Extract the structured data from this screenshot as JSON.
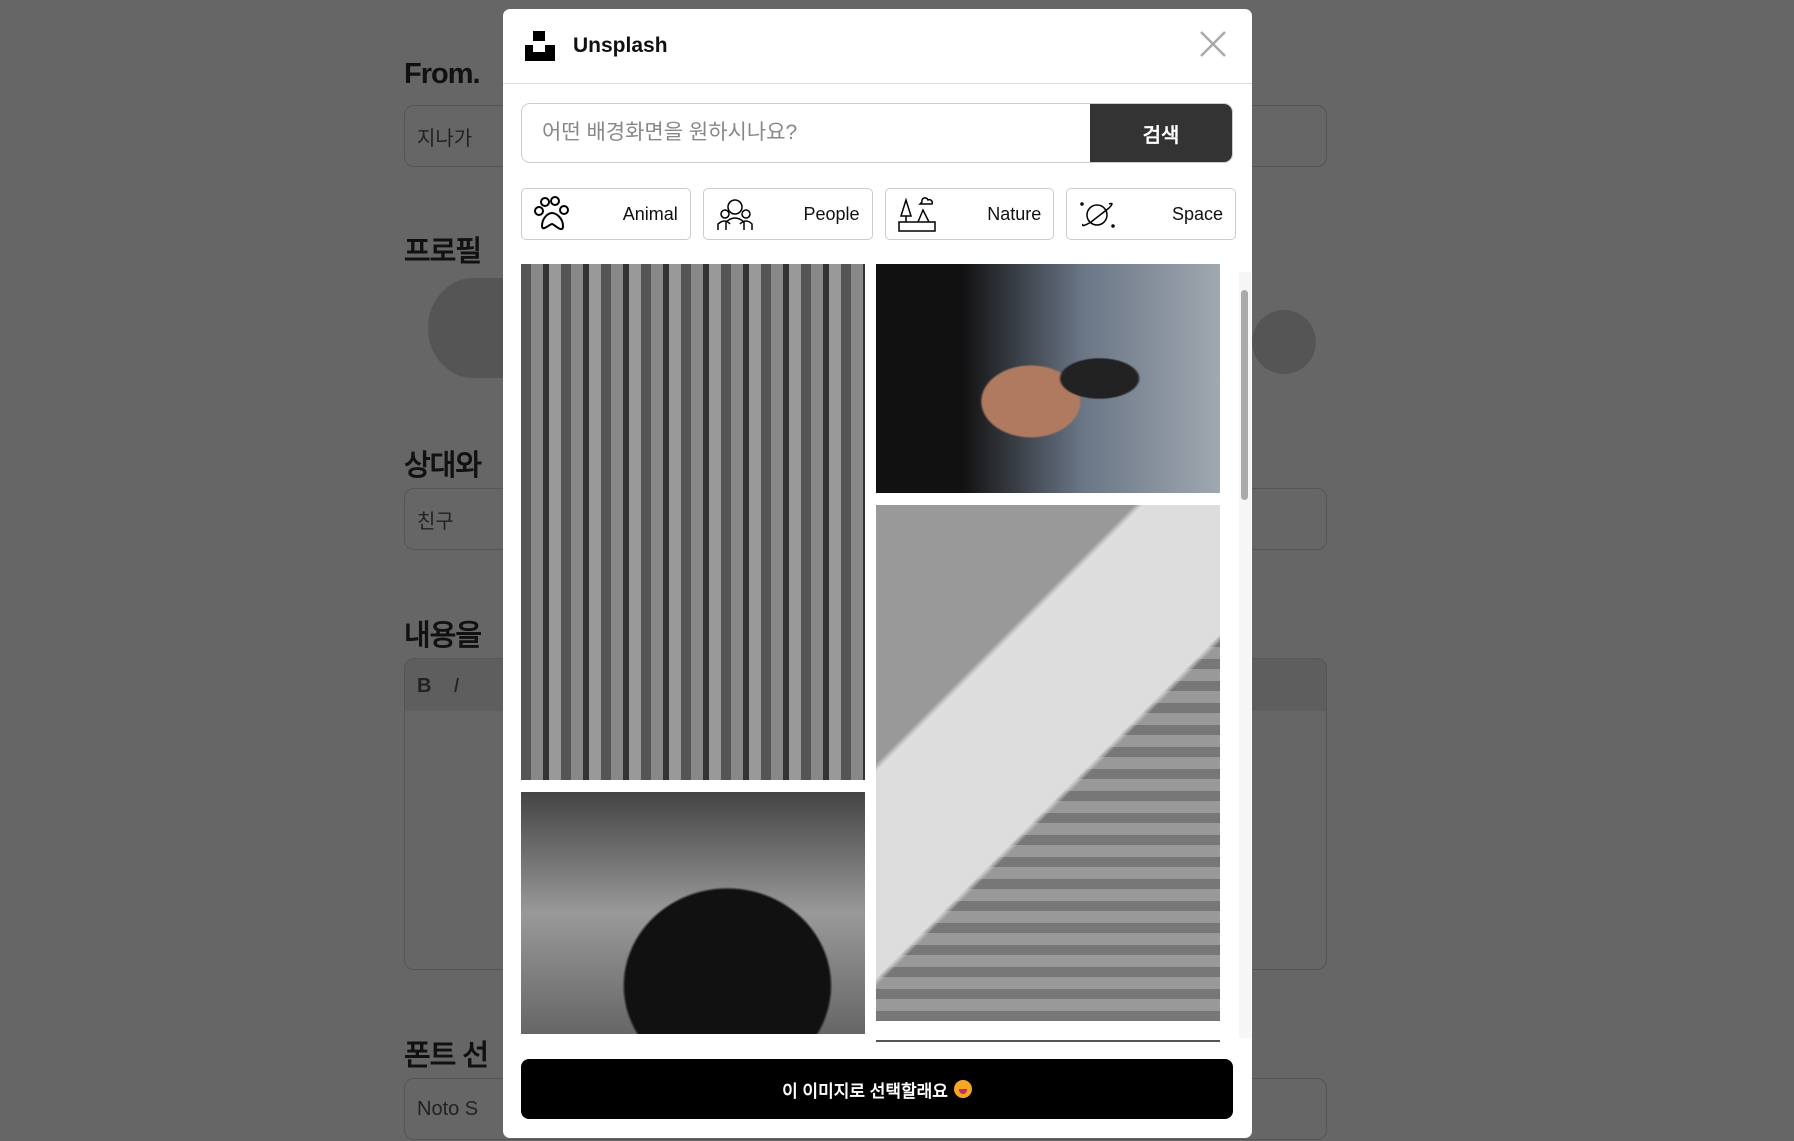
{
  "background": {
    "from_label": "From.",
    "from_value": "지나가",
    "profile_label": "프로필",
    "relation_label": "상대와",
    "relation_value": "친구",
    "content_label": "내용을",
    "toolbar": [
      "B",
      "I"
    ],
    "font_label": "폰트 선",
    "font_value": "Noto S"
  },
  "modal": {
    "title": "Unsplash",
    "search_placeholder": "어떤 배경화면을 원하시나요?",
    "search_value": "",
    "search_button": "검색",
    "categories": [
      {
        "label": "Animal",
        "icon": "paw-icon"
      },
      {
        "label": "People",
        "icon": "people-icon"
      },
      {
        "label": "Nature",
        "icon": "nature-icon"
      },
      {
        "label": "Space",
        "icon": "planet-icon"
      }
    ],
    "confirm_button": "이 이미지로 선택할래요"
  }
}
